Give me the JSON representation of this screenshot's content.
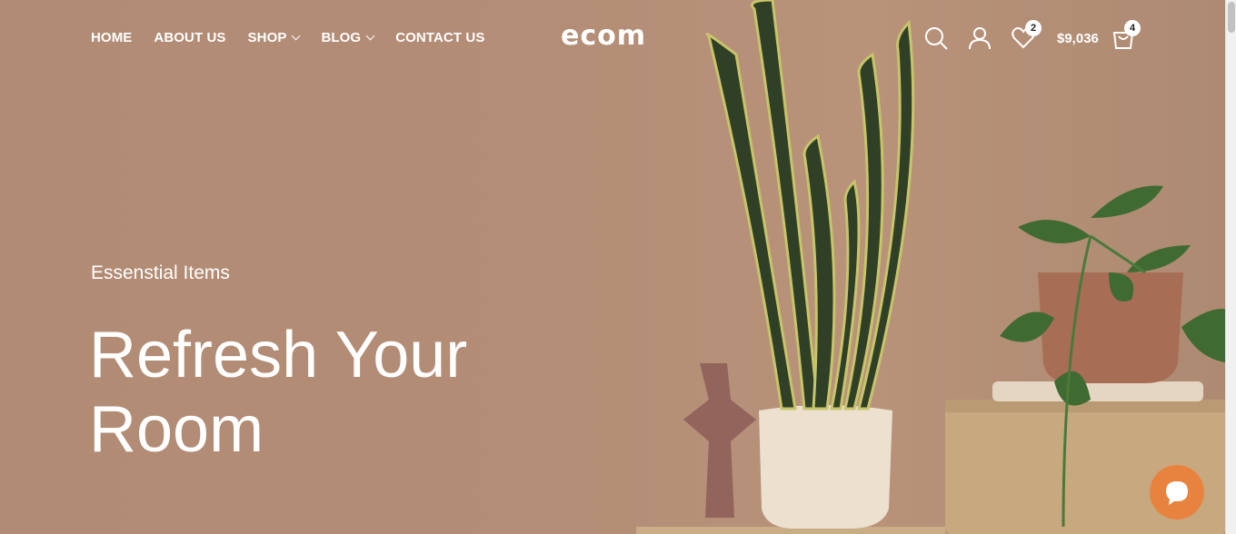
{
  "header": {
    "nav": [
      {
        "label": "HOME",
        "has_dropdown": false
      },
      {
        "label": "ABOUT US",
        "has_dropdown": false
      },
      {
        "label": "SHOP",
        "has_dropdown": true
      },
      {
        "label": "BLOG",
        "has_dropdown": true
      },
      {
        "label": "CONTACT US",
        "has_dropdown": false
      }
    ],
    "logo": "ecom",
    "icons": {
      "search": "search-icon",
      "account": "user-icon",
      "wishlist": "heart-icon",
      "cart": "bag-icon"
    },
    "wishlist_count": "2",
    "cart_total": "$9,036",
    "cart_count": "4"
  },
  "hero": {
    "eyebrow": "Essenstial Items",
    "headline": "Refresh Your Room"
  },
  "chat": {
    "icon": "chat-bubble-icon"
  },
  "colors": {
    "background": "#b18b74",
    "chat_button": "#e8833f",
    "text": "#ffffff"
  }
}
